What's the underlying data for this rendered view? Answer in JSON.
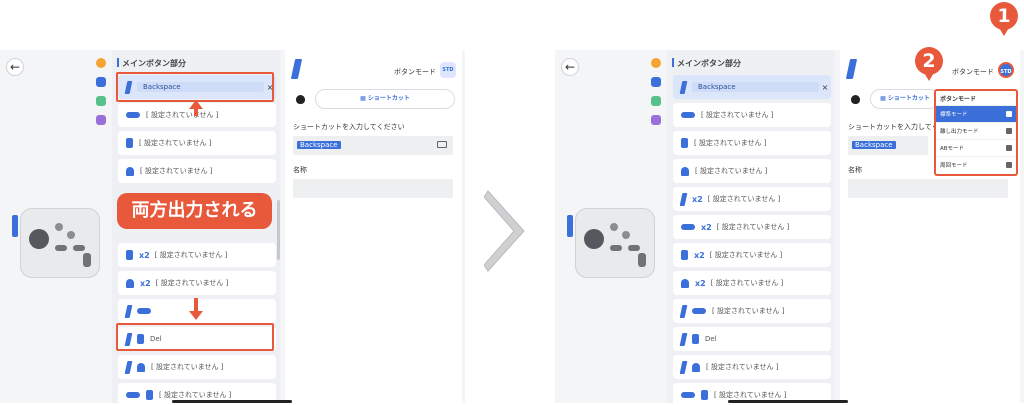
{
  "section_title": "メインボタン部分",
  "back_icon": "arrow-left-icon",
  "first_row_value": "Backspace",
  "unset_label": "[ 設定されていません ]",
  "multiplier": "x2",
  "del_value": "Del",
  "mode_label": "ボタンモード",
  "std_badge": "STD",
  "shortcut_label": "ショートカット",
  "prompt_label": "ショートカットを入力してください",
  "input_value": "Backspace",
  "name_label": "名称",
  "callout_text": "両方出力される",
  "dropdown": {
    "title": "ボタンモード",
    "items": [
      "標準モード",
      "離し出力モード",
      "ABモード",
      "周回モード"
    ],
    "selected": "標準モード"
  },
  "badges": [
    "1",
    "2"
  ],
  "colors": {
    "accent": "#3b6fd9",
    "annotation": "#e8583b"
  }
}
